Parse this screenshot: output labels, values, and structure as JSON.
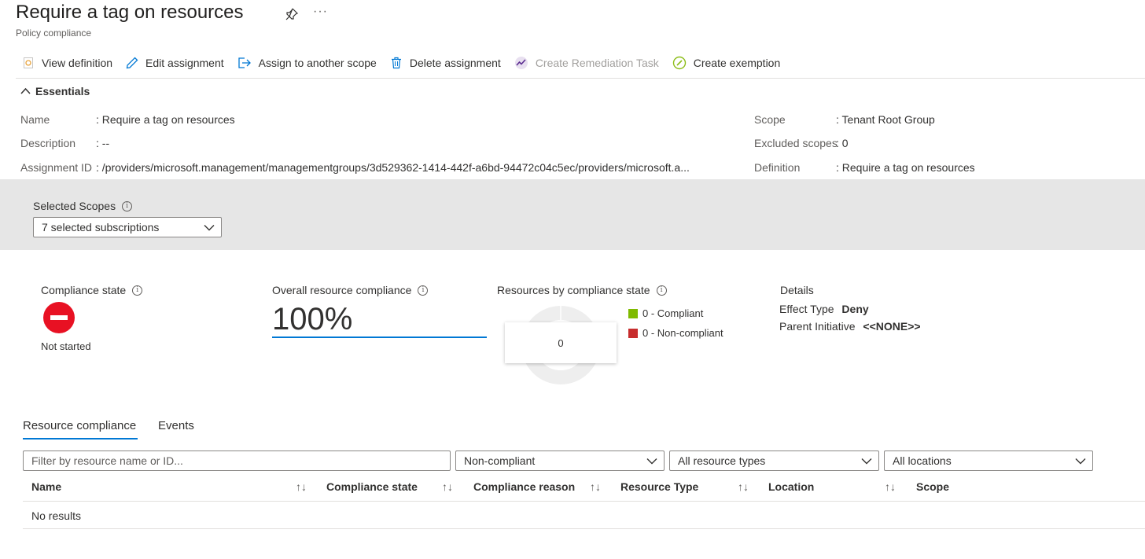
{
  "header": {
    "title": "Require a tag on resources",
    "subtitle": "Policy compliance",
    "more": "···"
  },
  "toolbar": {
    "view_definition": "View definition",
    "edit_assignment": "Edit assignment",
    "assign_scope": "Assign to another scope",
    "delete_assignment": "Delete assignment",
    "create_remediation": "Create Remediation Task",
    "create_exemption": "Create exemption"
  },
  "essentials": {
    "heading": "Essentials",
    "name_label": "Name",
    "name_value": ": Require a tag on resources",
    "description_label": "Description",
    "description_value": ": --",
    "assignment_label": "Assignment ID",
    "assignment_value": ": /providers/microsoft.management/managementgroups/3d529362-1414-442f-a6bd-94472c04c5ec/providers/microsoft.a...",
    "scope_label": "Scope",
    "scope_value": ": Tenant Root Group",
    "excluded_label": "Excluded scopes",
    "excluded_value": ": 0",
    "definition_label": "Definition",
    "definition_value": ": Require a tag on resources"
  },
  "scopes": {
    "label": "Selected Scopes",
    "value": "7 selected subscriptions"
  },
  "compliance": {
    "state_label": "Compliance state",
    "state_value": "Not started",
    "overall_label": "Overall resource compliance",
    "overall_value": "100%",
    "by_state_label": "Resources by compliance state",
    "tooltip_value": "0",
    "legend": [
      {
        "label": "0 - Compliant",
        "color": "#7fba00"
      },
      {
        "label": "0 - Non-compliant",
        "color": "#c72d2d"
      }
    ]
  },
  "details": {
    "heading": "Details",
    "effect_label": "Effect Type",
    "effect_value": "Deny",
    "parent_label": "Parent Initiative",
    "parent_value": "<<NONE>>"
  },
  "tabs": {
    "resource_compliance": "Resource compliance",
    "events": "Events"
  },
  "filters": {
    "search_placeholder": "Filter by resource name or ID...",
    "compliance_filter": "Non-compliant",
    "type_filter": "All resource types",
    "location_filter": "All locations"
  },
  "table": {
    "columns": [
      "Name",
      "Compliance state",
      "Compliance reason",
      "Resource Type",
      "Location",
      "Scope"
    ],
    "sort_glyph": "↑↓",
    "empty": "No results"
  },
  "colors": {
    "accent": "#0078d4",
    "error": "#e81123"
  }
}
